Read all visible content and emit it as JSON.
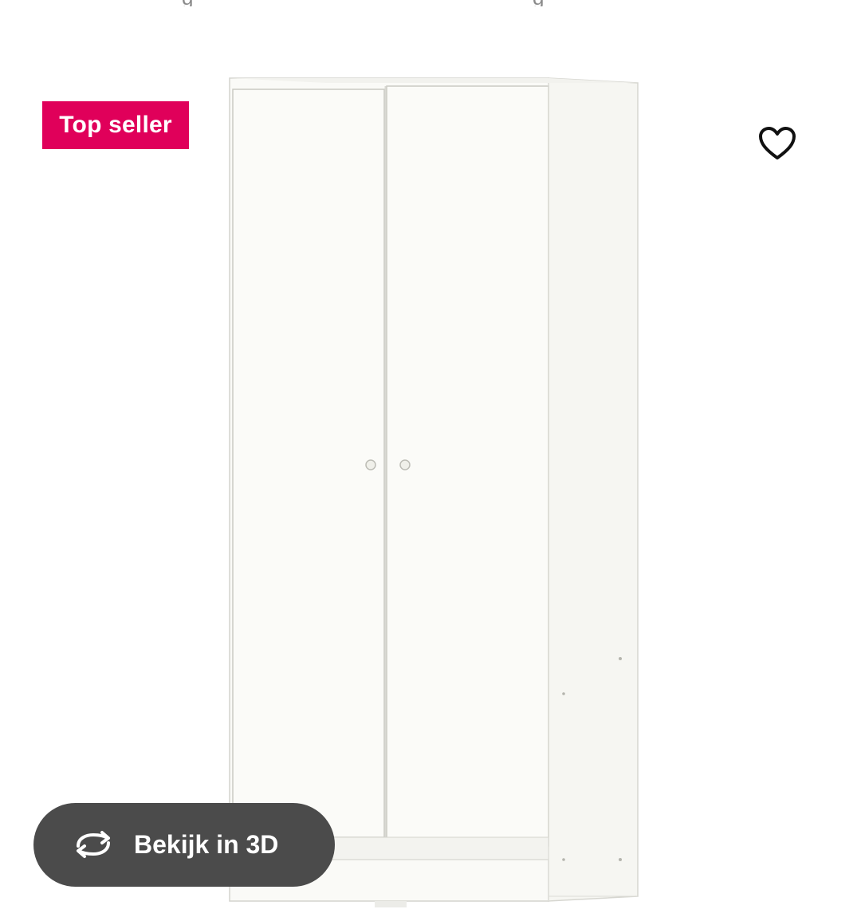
{
  "badge": {
    "label": "Top seller",
    "color": "#e0005a"
  },
  "favorite": {
    "icon": "heart-outline-icon"
  },
  "product_image": {
    "description_icon": "wardrobe-image"
  },
  "view3d": {
    "label": "Bekijk in 3D",
    "icon": "rotate-3d-icon",
    "background": "#4b4b4b"
  }
}
